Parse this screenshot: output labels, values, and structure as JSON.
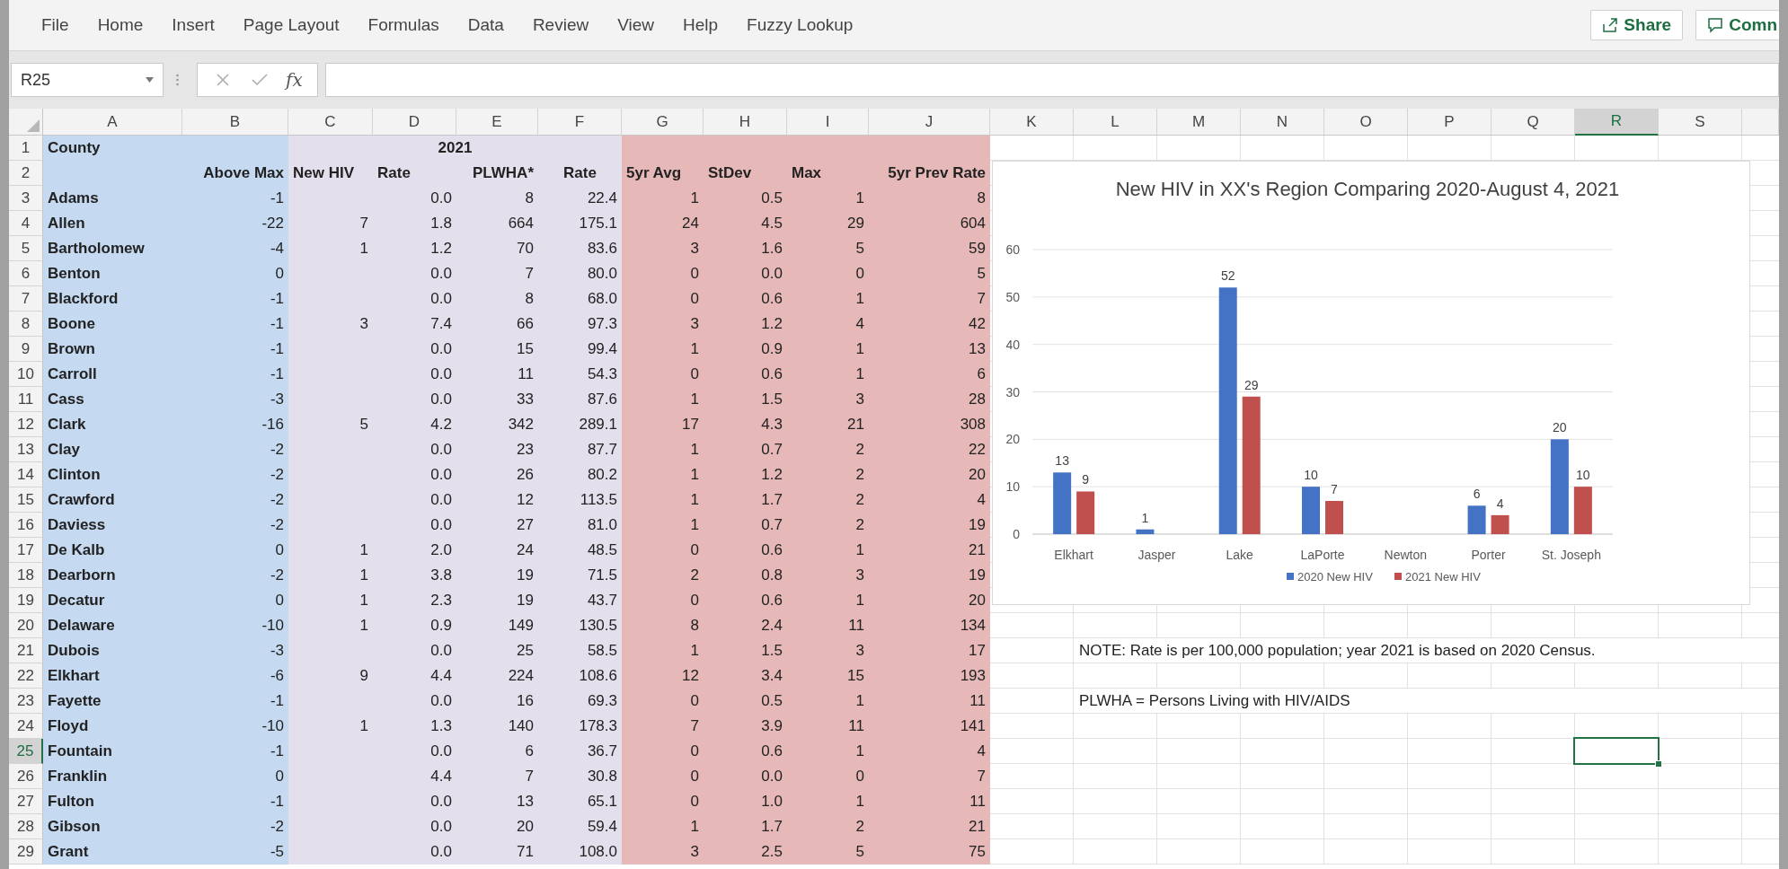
{
  "ribbon": {
    "tabs": [
      "File",
      "Home",
      "Insert",
      "Page Layout",
      "Formulas",
      "Data",
      "Review",
      "View",
      "Help",
      "Fuzzy Lookup"
    ],
    "share_button": "Share",
    "comments_button": "Comn"
  },
  "formula_bar": {
    "name_box": "R25",
    "insert_function": "fx"
  },
  "sheet": {
    "columns": [
      {
        "label": "A",
        "selected": false
      },
      {
        "label": "B",
        "selected": false
      },
      {
        "label": "C",
        "selected": false
      },
      {
        "label": "D",
        "selected": false
      },
      {
        "label": "E",
        "selected": false
      },
      {
        "label": "F",
        "selected": false
      },
      {
        "label": "G",
        "selected": false
      },
      {
        "label": "H",
        "selected": false
      },
      {
        "label": "I",
        "selected": false
      },
      {
        "label": "J",
        "selected": false
      },
      {
        "label": "K",
        "selected": false
      },
      {
        "label": "L",
        "selected": false
      },
      {
        "label": "M",
        "selected": false
      },
      {
        "label": "N",
        "selected": false
      },
      {
        "label": "O",
        "selected": false
      },
      {
        "label": "P",
        "selected": false
      },
      {
        "label": "Q",
        "selected": false
      },
      {
        "label": "R",
        "selected": true
      },
      {
        "label": "S",
        "selected": false
      }
    ],
    "rows": [
      {
        "label": "1",
        "selected": false
      },
      {
        "label": "2",
        "selected": false
      },
      {
        "label": "3",
        "selected": false
      },
      {
        "label": "4",
        "selected": false
      },
      {
        "label": "5",
        "selected": false
      },
      {
        "label": "6",
        "selected": false
      },
      {
        "label": "7",
        "selected": false
      },
      {
        "label": "8",
        "selected": false
      },
      {
        "label": "9",
        "selected": false
      },
      {
        "label": "10",
        "selected": false
      },
      {
        "label": "11",
        "selected": false
      },
      {
        "label": "12",
        "selected": false
      },
      {
        "label": "13",
        "selected": false
      },
      {
        "label": "14",
        "selected": false
      },
      {
        "label": "15",
        "selected": false
      },
      {
        "label": "16",
        "selected": false
      },
      {
        "label": "17",
        "selected": false
      },
      {
        "label": "18",
        "selected": false
      },
      {
        "label": "19",
        "selected": false
      },
      {
        "label": "20",
        "selected": false
      },
      {
        "label": "21",
        "selected": false
      },
      {
        "label": "22",
        "selected": false
      },
      {
        "label": "23",
        "selected": false
      },
      {
        "label": "24",
        "selected": false
      },
      {
        "label": "25",
        "selected": true
      },
      {
        "label": "26",
        "selected": false
      },
      {
        "label": "27",
        "selected": false
      },
      {
        "label": "28",
        "selected": false
      },
      {
        "label": "29",
        "selected": false
      }
    ],
    "title_row": {
      "county": "County",
      "year": "2021"
    },
    "header_row": [
      "Above Max",
      "New HIV",
      "Rate",
      "PLWHA*",
      "Rate",
      "5yr Avg",
      "StDev",
      "Max",
      "5yr Prev Rate"
    ],
    "data_rows": [
      [
        "Adams",
        "-1",
        null,
        "0.0",
        "8",
        "22.4",
        "1",
        "0.5",
        "1",
        "8"
      ],
      [
        "Allen",
        "-22",
        "7",
        "1.8",
        "664",
        "175.1",
        "24",
        "4.5",
        "29",
        "604"
      ],
      [
        "Bartholomew",
        "-4",
        "1",
        "1.2",
        "70",
        "83.6",
        "3",
        "1.6",
        "5",
        "59"
      ],
      [
        "Benton",
        "0",
        null,
        "0.0",
        "7",
        "80.0",
        "0",
        "0.0",
        "0",
        "5"
      ],
      [
        "Blackford",
        "-1",
        null,
        "0.0",
        "8",
        "68.0",
        "0",
        "0.6",
        "1",
        "7"
      ],
      [
        "Boone",
        "-1",
        "3",
        "7.4",
        "66",
        "97.3",
        "3",
        "1.2",
        "4",
        "42"
      ],
      [
        "Brown",
        "-1",
        null,
        "0.0",
        "15",
        "99.4",
        "1",
        "0.9",
        "1",
        "13"
      ],
      [
        "Carroll",
        "-1",
        null,
        "0.0",
        "11",
        "54.3",
        "0",
        "0.6",
        "1",
        "6"
      ],
      [
        "Cass",
        "-3",
        null,
        "0.0",
        "33",
        "87.6",
        "1",
        "1.5",
        "3",
        "28"
      ],
      [
        "Clark",
        "-16",
        "5",
        "4.2",
        "342",
        "289.1",
        "17",
        "4.3",
        "21",
        "308"
      ],
      [
        "Clay",
        "-2",
        null,
        "0.0",
        "23",
        "87.7",
        "1",
        "0.7",
        "2",
        "22"
      ],
      [
        "Clinton",
        "-2",
        null,
        "0.0",
        "26",
        "80.2",
        "1",
        "1.2",
        "2",
        "20"
      ],
      [
        "Crawford",
        "-2",
        null,
        "0.0",
        "12",
        "113.5",
        "1",
        "1.7",
        "2",
        "4"
      ],
      [
        "Daviess",
        "-2",
        null,
        "0.0",
        "27",
        "81.0",
        "1",
        "0.7",
        "2",
        "19"
      ],
      [
        "De Kalb",
        "0",
        "1",
        "2.0",
        "24",
        "48.5",
        "0",
        "0.6",
        "1",
        "21"
      ],
      [
        "Dearborn",
        "-2",
        "1",
        "3.8",
        "19",
        "71.5",
        "2",
        "0.8",
        "3",
        "19"
      ],
      [
        "Decatur",
        "0",
        "1",
        "2.3",
        "19",
        "43.7",
        "0",
        "0.6",
        "1",
        "20"
      ],
      [
        "Delaware",
        "-10",
        "1",
        "0.9",
        "149",
        "130.5",
        "8",
        "2.4",
        "11",
        "134"
      ],
      [
        "Dubois",
        "-3",
        null,
        "0.0",
        "25",
        "58.5",
        "1",
        "1.5",
        "3",
        "17"
      ],
      [
        "Elkhart",
        "-6",
        "9",
        "4.4",
        "224",
        "108.6",
        "12",
        "3.4",
        "15",
        "193"
      ],
      [
        "Fayette",
        "-1",
        null,
        "0.0",
        "16",
        "69.3",
        "0",
        "0.5",
        "1",
        "11"
      ],
      [
        "Floyd",
        "-10",
        "1",
        "1.3",
        "140",
        "178.3",
        "7",
        "3.9",
        "11",
        "141"
      ],
      [
        "Fountain",
        "-1",
        null,
        "0.0",
        "6",
        "36.7",
        "0",
        "0.6",
        "1",
        "4"
      ],
      [
        "Franklin",
        "0",
        null,
        "4.4",
        "7",
        "30.8",
        "0",
        "0.0",
        "0",
        "7"
      ],
      [
        "Fulton",
        "-1",
        null,
        "0.0",
        "13",
        "65.1",
        "0",
        "1.0",
        "1",
        "11"
      ],
      [
        "Gibson",
        "-2",
        null,
        "0.0",
        "20",
        "59.4",
        "1",
        "1.7",
        "2",
        "21"
      ],
      [
        "Grant",
        "-5",
        null,
        "0.0",
        "71",
        "108.0",
        "3",
        "2.5",
        "5",
        "75"
      ]
    ],
    "notes": [
      "NOTE: Rate is per 100,000 population; year 2021 is based on 2020 Census.",
      "PLWHA = Persons Living with HIV/AIDS"
    ]
  },
  "chart": {
    "chart_data": {
      "type": "bar",
      "title": "New HIV in XX's Region Comparing 2020-August 4, 2021",
      "categories": [
        "Elkhart",
        "Jasper",
        "Lake",
        "LaPorte",
        "Newton",
        "Porter",
        "St. Joseph"
      ],
      "series": [
        {
          "name": "2020 New HIV",
          "color": "#4472c4",
          "values": [
            13,
            1,
            52,
            10,
            null,
            6,
            20
          ]
        },
        {
          "name": "2021 New HIV",
          "color": "#c0504d",
          "values": [
            9,
            null,
            29,
            7,
            null,
            4,
            10
          ]
        }
      ],
      "ylim": [
        0,
        60
      ],
      "yticks": [
        0,
        10,
        20,
        30,
        40,
        50,
        60
      ],
      "grid": true,
      "legend": "bottom",
      "data_labels": true
    }
  }
}
